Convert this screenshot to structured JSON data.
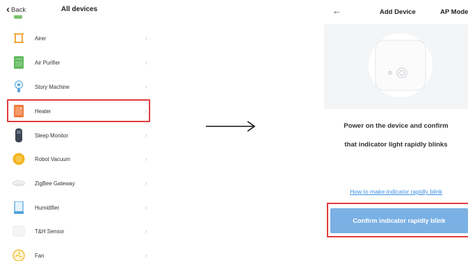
{
  "left_panel": {
    "back_label": "Back",
    "title": "All devices",
    "devices": [
      {
        "label": "Airer",
        "icon": "airer-icon"
      },
      {
        "label": "Air Purifier",
        "icon": "air-purifier-icon"
      },
      {
        "label": "Story Machine",
        "icon": "story-machine-icon"
      },
      {
        "label": "Heater",
        "icon": "heater-icon"
      },
      {
        "label": "Sleep Monitor",
        "icon": "sleep-monitor-icon"
      },
      {
        "label": "Robot Vacuum",
        "icon": "robot-vacuum-icon"
      },
      {
        "label": "ZigBee Gateway",
        "icon": "zigbee-gateway-icon"
      },
      {
        "label": "Humidifier",
        "icon": "humidifier-icon"
      },
      {
        "label": "T&H Sensor",
        "icon": "th-sensor-icon"
      },
      {
        "label": "Fan",
        "icon": "fan-icon"
      }
    ],
    "highlighted_device": "Heater"
  },
  "right_panel": {
    "title": "Add Device",
    "mode_label": "AP Mode",
    "instruction_line1": "Power on the device and confirm",
    "instruction_line2": "that indicator light rapidly blinks",
    "help_link": "How to make indicator rapidly blink",
    "confirm_button": "Confirm indicator rapidly blink"
  },
  "colors": {
    "highlight_border": "#e03b3b",
    "link": "#3a8fe0",
    "button_bg": "#7ab0e4"
  }
}
